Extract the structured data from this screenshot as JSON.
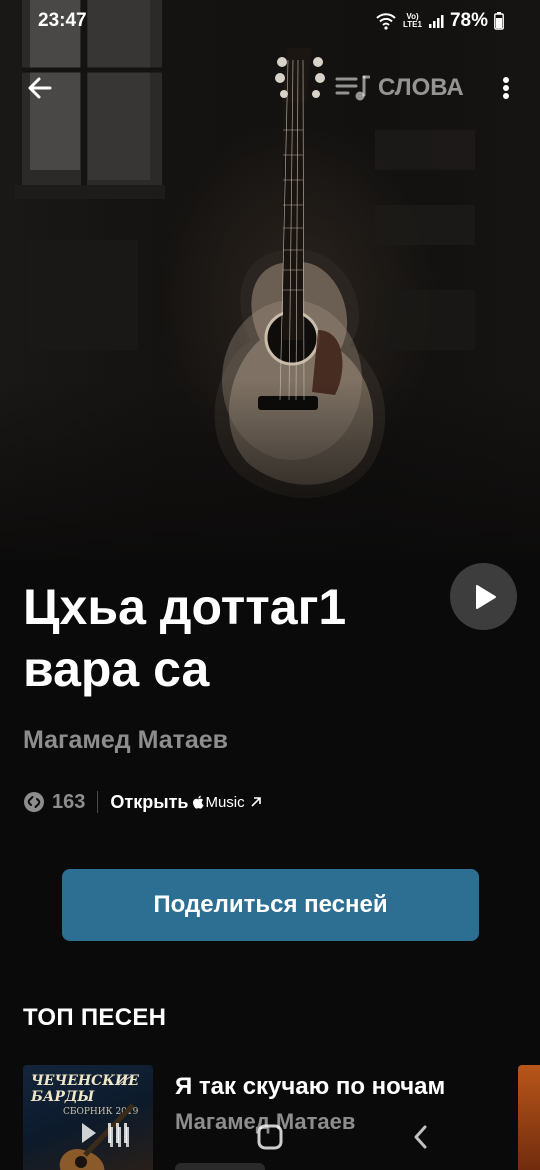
{
  "status_bar": {
    "time": "23:47",
    "network_label_top": "Vo)",
    "network_label_bottom": "LTE1",
    "battery": "78%"
  },
  "toolbar": {
    "back_icon": "arrow-left-icon",
    "lyrics_label": "СЛОВА",
    "lyrics_icon": "lyrics-icon",
    "more_icon": "more-vertical-icon"
  },
  "song": {
    "title": "Цхьа доттаг1 вара са",
    "artist": "Магамед Матаев",
    "shazam_count": "163",
    "open_label": "Открыть",
    "music_service": "Music",
    "external_icon": "arrow-up-right-icon"
  },
  "share": {
    "label": "Поделиться песней"
  },
  "top_songs": {
    "heading": "ТОП ПЕСЕН",
    "items": [
      {
        "title": "Я так скучаю по ночам",
        "artist": "Магамед Матаев",
        "cover_title": "Чеченские барды",
        "cover_subtitle": "СБОРНИК 2019"
      }
    ]
  },
  "nav_bar": {
    "recents_icon": "recents-icon",
    "home_icon": "home-icon",
    "back_icon": "back-chevron-icon"
  },
  "colors": {
    "background": "#0b0a0a",
    "share_button": "#2d6f93",
    "secondary_text": "#8d8d8d"
  }
}
